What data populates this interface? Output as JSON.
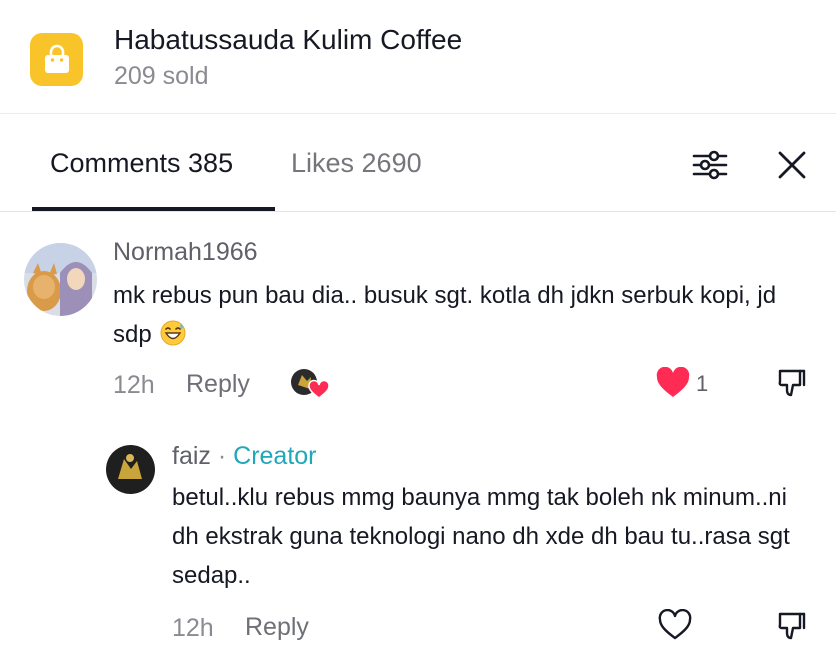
{
  "product": {
    "title": "Habatussauda Kulim Coffee",
    "sold": "209 sold",
    "icon": "shopping-bag-icon",
    "badge_color": "#f9c42a"
  },
  "tabs": {
    "comments_label": "Comments 385",
    "likes_label": "Likes 2690",
    "active": "comments"
  },
  "toolbar": {
    "filter_icon": "sliders-icon",
    "close_icon": "close-icon"
  },
  "comments": [
    {
      "username": "Normah1966",
      "text": "mk rebus pun bau dia.. busuk sgt. kotla dh jdkn serbuk kopi, jd sdp",
      "emoji": "grinning-sweat-emoji",
      "time": "12h",
      "reply_label": "Reply",
      "liked_by_creator": true,
      "liked": true,
      "like_count": "1",
      "reply": {
        "username": "faiz",
        "separator": "·",
        "tag": "Creator",
        "text": "betul..klu rebus mmg baunya mmg tak boleh nk minum..ni dh ekstrak guna teknologi nano dh xde dh bau tu..rasa sgt sedap..",
        "time": "12h",
        "reply_label": "Reply",
        "liked": false
      }
    }
  ],
  "colors": {
    "heart_active": "#fe2c55",
    "creator_tag": "#20a7b8"
  }
}
